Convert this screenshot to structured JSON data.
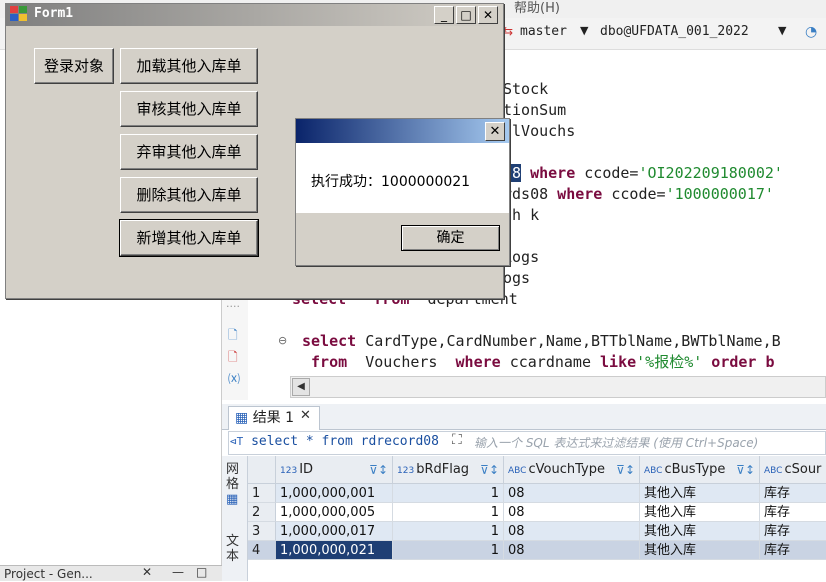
{
  "ide": {
    "menu_help": "帮助(H)",
    "db_name": "master",
    "connection": "dbo@UFDATA_001_2022",
    "editor_lines": [
      {
        "text": "Stock"
      },
      {
        "text": "tionSum"
      },
      {
        "text": "alVouchs"
      },
      {
        "text": ""
      },
      {
        "sel": "08",
        "kw1": " where ",
        "plain1": "ccode=",
        "str1": "'OI202209180002'"
      },
      {
        "plain0": "rds08",
        "kw1": " where ",
        "plain1": "ccode=",
        "str1": "'1000000017'"
      },
      {
        "text": "nh k"
      },
      {
        "text": ""
      },
      {
        "text": "Logs"
      },
      {
        "text": "ogs"
      },
      {
        "kw0": "select",
        "plain0": " * ",
        "kw1": "from",
        "plain1": "  department"
      },
      {
        "text": ""
      },
      {
        "kw0": "select",
        "plain0": " CardType,CardNumber,Name,BTTblName,BWTblName,B"
      },
      {
        "kw0": " from",
        "plain0": "  Vouchers  ",
        "kw1": "where",
        "plain1": " ccardname ",
        "kw2": "like",
        "str1": "'%报检%'",
        "kw3": " order b"
      }
    ],
    "results_tab_label": "结果 1",
    "filter_sql": "select * from rdrecord08",
    "filter_hint": "输入一个 SQL 表达式来过滤结果 (使用 Ctrl+Space)",
    "side_tab_grid": "网格",
    "side_tab_text": "文本",
    "project_tab_label": "Project - Gen..."
  },
  "grid": {
    "columns": [
      {
        "type": "123",
        "name": "ID"
      },
      {
        "type": "123",
        "name": "bRdFlag"
      },
      {
        "type": "ABC",
        "name": "cVouchType"
      },
      {
        "type": "ABC",
        "name": "cBusType"
      },
      {
        "type": "ABC",
        "name": "cSour"
      }
    ],
    "rows": [
      {
        "n": "1",
        "id": "1,000,000,001",
        "flag": "1",
        "vt": "08",
        "bt": "其他入库",
        "src": "库存"
      },
      {
        "n": "2",
        "id": "1,000,000,005",
        "flag": "1",
        "vt": "08",
        "bt": "其他入库",
        "src": "库存"
      },
      {
        "n": "3",
        "id": "1,000,000,017",
        "flag": "1",
        "vt": "08",
        "bt": "其他入库",
        "src": "库存"
      },
      {
        "n": "4",
        "id": "1,000,000,021",
        "flag": "1",
        "vt": "08",
        "bt": "其他入库",
        "src": "库存"
      }
    ]
  },
  "form1": {
    "title": "Form1",
    "login_button": "登录对象",
    "load_button": "加载其他入库单",
    "audit_button": "审核其他入库单",
    "unaudit_button": "弃审其他入库单",
    "delete_button": "删除其他入库单",
    "add_button": "新增其他入库单"
  },
  "msgbox": {
    "message": "执行成功：1000000021",
    "ok_button": "确定"
  }
}
